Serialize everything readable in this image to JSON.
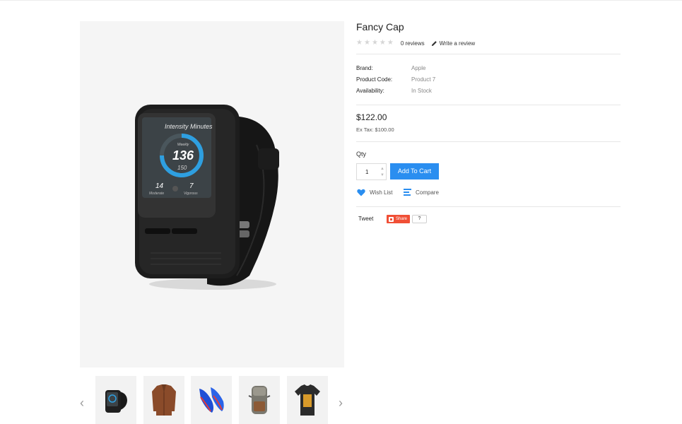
{
  "product": {
    "title": "Fancy Cap",
    "reviews_text": "0 reviews",
    "write_review": "Write a review",
    "rating": 0,
    "rating_max": 5
  },
  "specs": [
    {
      "label": "Brand:",
      "value": "Apple"
    },
    {
      "label": "Product Code:",
      "value": "Product 7"
    },
    {
      "label": "Availability:",
      "value": "In Stock"
    }
  ],
  "pricing": {
    "price": "$122.00",
    "ex_tax": "Ex Tax: $100.00"
  },
  "purchase": {
    "qty_label": "Qty",
    "qty_value": "1",
    "add_to_cart": "Add To Cart",
    "wish_list": "Wish List",
    "compare": "Compare"
  },
  "social": {
    "tweet": "Tweet",
    "share": "Share",
    "share_count": "?"
  },
  "main_image": {
    "watch_screen_title": "Intensity Minutes",
    "watch_weekly": "Weekly",
    "watch_value": "136",
    "watch_goal": "150",
    "watch_moderate_value": "14",
    "watch_moderate_label": "Moderate",
    "watch_vigorous_value": "7",
    "watch_vigorous_label": "Vigorous"
  },
  "thumbnails": [
    {
      "name": "watch"
    },
    {
      "name": "leather-jacket"
    },
    {
      "name": "sneakers"
    },
    {
      "name": "backpack"
    },
    {
      "name": "t-shirt"
    }
  ],
  "icons": {
    "prev": "chevron-left-icon",
    "next": "chevron-right-icon",
    "star": "star-icon",
    "pencil": "pencil-icon",
    "heart": "heart-icon",
    "compare": "compare-icon"
  },
  "colors": {
    "accent": "#2a8ef0",
    "share": "#f04f36",
    "image_bg": "#f5f5f5"
  }
}
